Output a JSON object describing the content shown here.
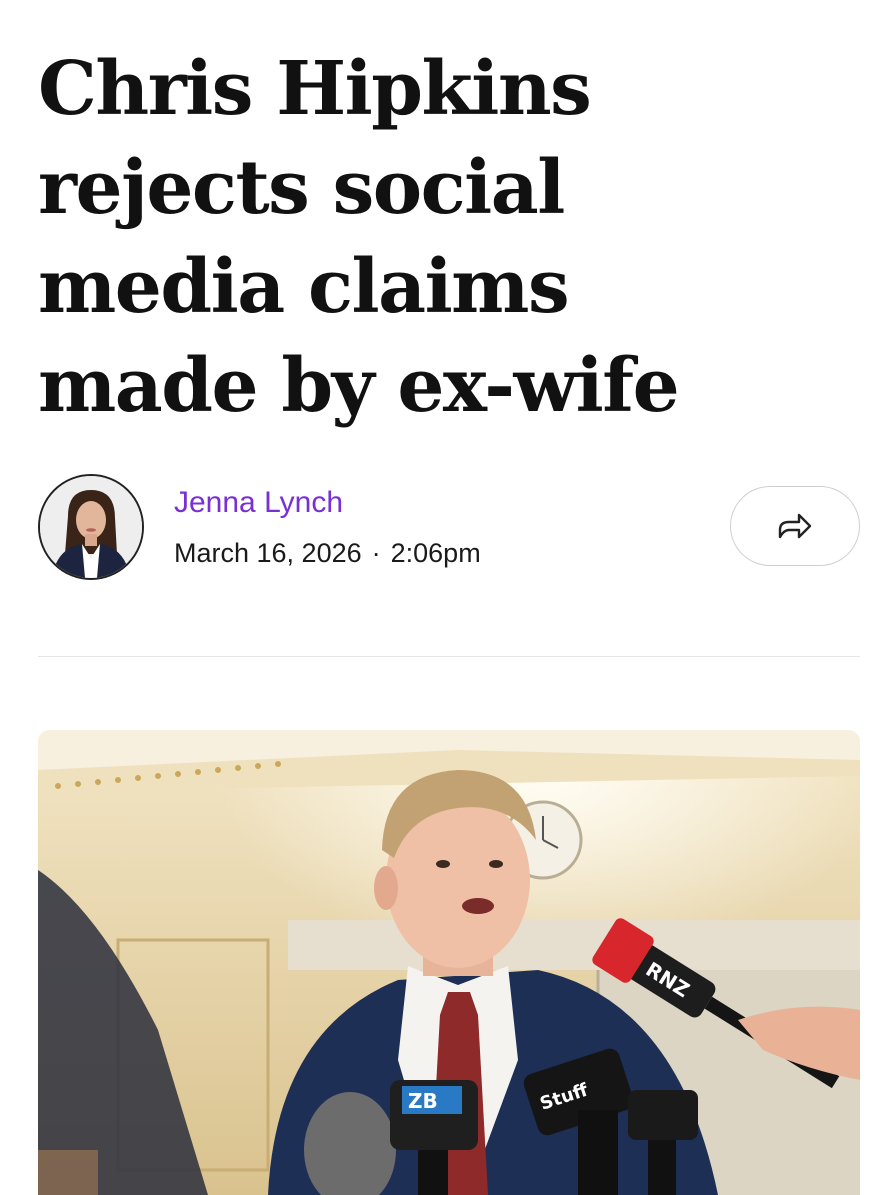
{
  "article": {
    "headline_lines": [
      "Chris Hipkins",
      "rejects social",
      "media claims",
      "made by ex-wife"
    ],
    "author": {
      "name": "Jenna Lynch",
      "avatar_icon": "author-portrait"
    },
    "date": "March 16, 2026",
    "separator": "·",
    "time": "2:06pm",
    "share_icon": "share-arrow-icon",
    "accent_color": "#7a2fd6"
  },
  "photo": {
    "mic_labels": {
      "rnz": "RNZ",
      "zb": "ZB",
      "stuff": "Stuff"
    },
    "colors": {
      "wall": "#e8d6a8",
      "suit": "#1e2f55",
      "tie": "#8e2a2a",
      "rnz_red": "#d7262c"
    }
  }
}
